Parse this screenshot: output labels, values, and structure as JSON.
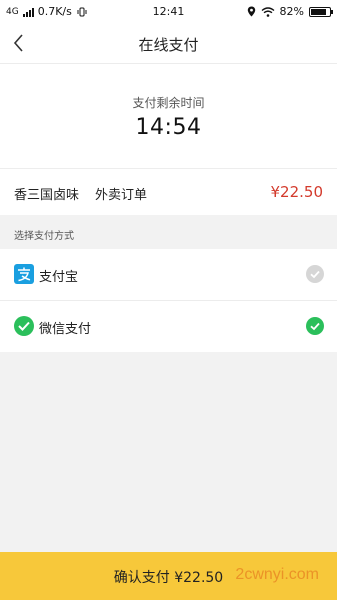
{
  "status_bar": {
    "network": "4G",
    "speed": "0.7K/s",
    "time": "12:41",
    "battery": "82%",
    "battery_level": 0.82
  },
  "nav": {
    "title": "在线支付",
    "back_icon": "chevron-left-icon"
  },
  "timer": {
    "label": "支付剩余时间",
    "value": "14:54"
  },
  "order": {
    "store": "香三国卤味",
    "type": "外卖订单",
    "price": "¥22.50"
  },
  "payment": {
    "section_label": "选择支付方式",
    "methods": [
      {
        "name": "支付宝",
        "icon": "alipay-icon",
        "selected": false
      },
      {
        "name": "微信支付",
        "icon": "wechat-icon",
        "selected": true
      }
    ]
  },
  "footer": {
    "confirm": "确认支付 ¥22.50",
    "watermark": "2cwnyi.com"
  },
  "colors": {
    "accent": "#f7c83a",
    "price": "#d33a2c",
    "selected": "#2bbf5b",
    "unselected": "#d6d6d6"
  }
}
